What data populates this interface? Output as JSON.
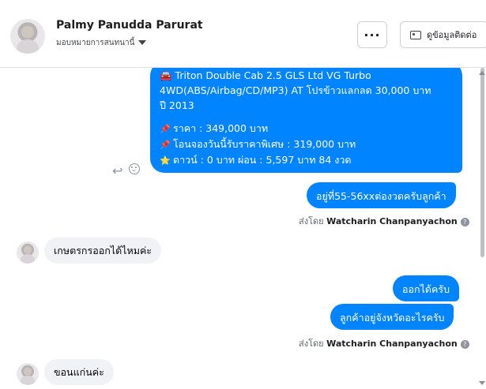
{
  "header": {
    "contact_name": "Palmy Panudda Parurat",
    "assign_label": "มอบหมายการสนทนานี้",
    "more_label": "···",
    "contact_info_label": "ดูข้อมูลติดต่อ"
  },
  "messages": {
    "listing": {
      "line1": "🚘 Triton Double Cab 2.5 GLS Ltd VG Turbo",
      "line2": "4WD(ABS/Airbag/CD/MP3) AT โปรข้าวแลกลด 30,000 บาท",
      "line3": "ปี 2013",
      "price": "ราคา : 349,000 บาท",
      "special": "โอนจองวันนี้รับราคาพิเศษ : 319,000 บาท",
      "down": "ดาวน์ : 0 บาท ผ่อน : 5,597 บาท 84 งวด",
      "price_icon": "📌",
      "special_icon": "📌",
      "down_icon": "⭐"
    },
    "installment": "อยู่ที่55-56xxต่องวดครับลูกค้า",
    "sent_by_1": {
      "prefix": "ส่งโดย",
      "agent": "Watcharin Chanpanyachon",
      "help": "?"
    },
    "q_farmer": "เกษตรกรออกได้ไหมค่ะ",
    "a_yes": "ออกได้ครับ",
    "a_province": "ลูกค้าอยู่จังหวัดอะไรครับ",
    "sent_by_2": {
      "prefix": "ส่งโดย",
      "agent": "Watcharin Chanpanyachon",
      "help": "?"
    },
    "q_province": "ขอนแก่นค่ะ"
  },
  "icons": {
    "reply": "↩",
    "colors": {
      "outgoing": "#0084ff",
      "incoming": "#f0f2f5"
    }
  }
}
